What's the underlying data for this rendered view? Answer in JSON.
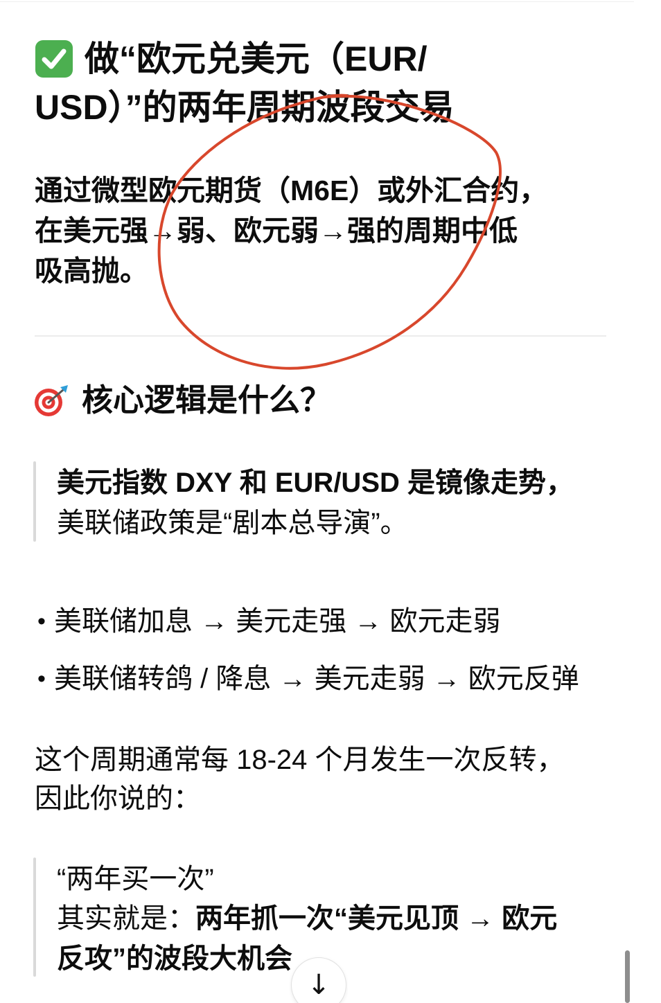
{
  "colors": {
    "text": "#0d0d0d",
    "background": "#ffffff",
    "check_green": "#4caf50",
    "annotation_red": "#d8472c",
    "quote_border": "#d9d9d9",
    "divider": "#ececec"
  },
  "heading": {
    "icon": "check-mark-button-icon",
    "lines": [
      "做“欧元兑美元（EUR/",
      "USD）”的两年周期波段交易"
    ]
  },
  "intro": {
    "lines": [
      "通过微型欧元期货（M6E）或外汇合约，",
      "在美元强→弱、欧元弱→强的周期中低",
      "吸高抛。"
    ]
  },
  "section": {
    "icon": "direct-hit-icon",
    "title": "核心逻辑是什么？"
  },
  "quote_core": {
    "lines": [
      "美元指数 DXY 和 EUR/USD 是镜像走势，",
      "美联储政策是“剧本总导演”。"
    ]
  },
  "bullet_glyph": "•",
  "bullets": [
    "美联储加息 → 美元走强 → 欧元走弱",
    "美联储转鸽 / 降息 → 美元走弱 → 欧元反弹"
  ],
  "cycle_paragraph": {
    "lines": [
      "这个周期通常每 18-24 个月发生一次反转，",
      "因此你说的："
    ]
  },
  "quote_takeaway": {
    "line1": "“两年买一次”",
    "line2_prefix": "其实就是：",
    "line2_emphasis": "两年抓一次“美元见顶 → 欧元",
    "line3_emphasis": "反攻”的波段大机会"
  },
  "scroll_button": {
    "icon": "arrow-down-icon",
    "glyph": "↓"
  }
}
